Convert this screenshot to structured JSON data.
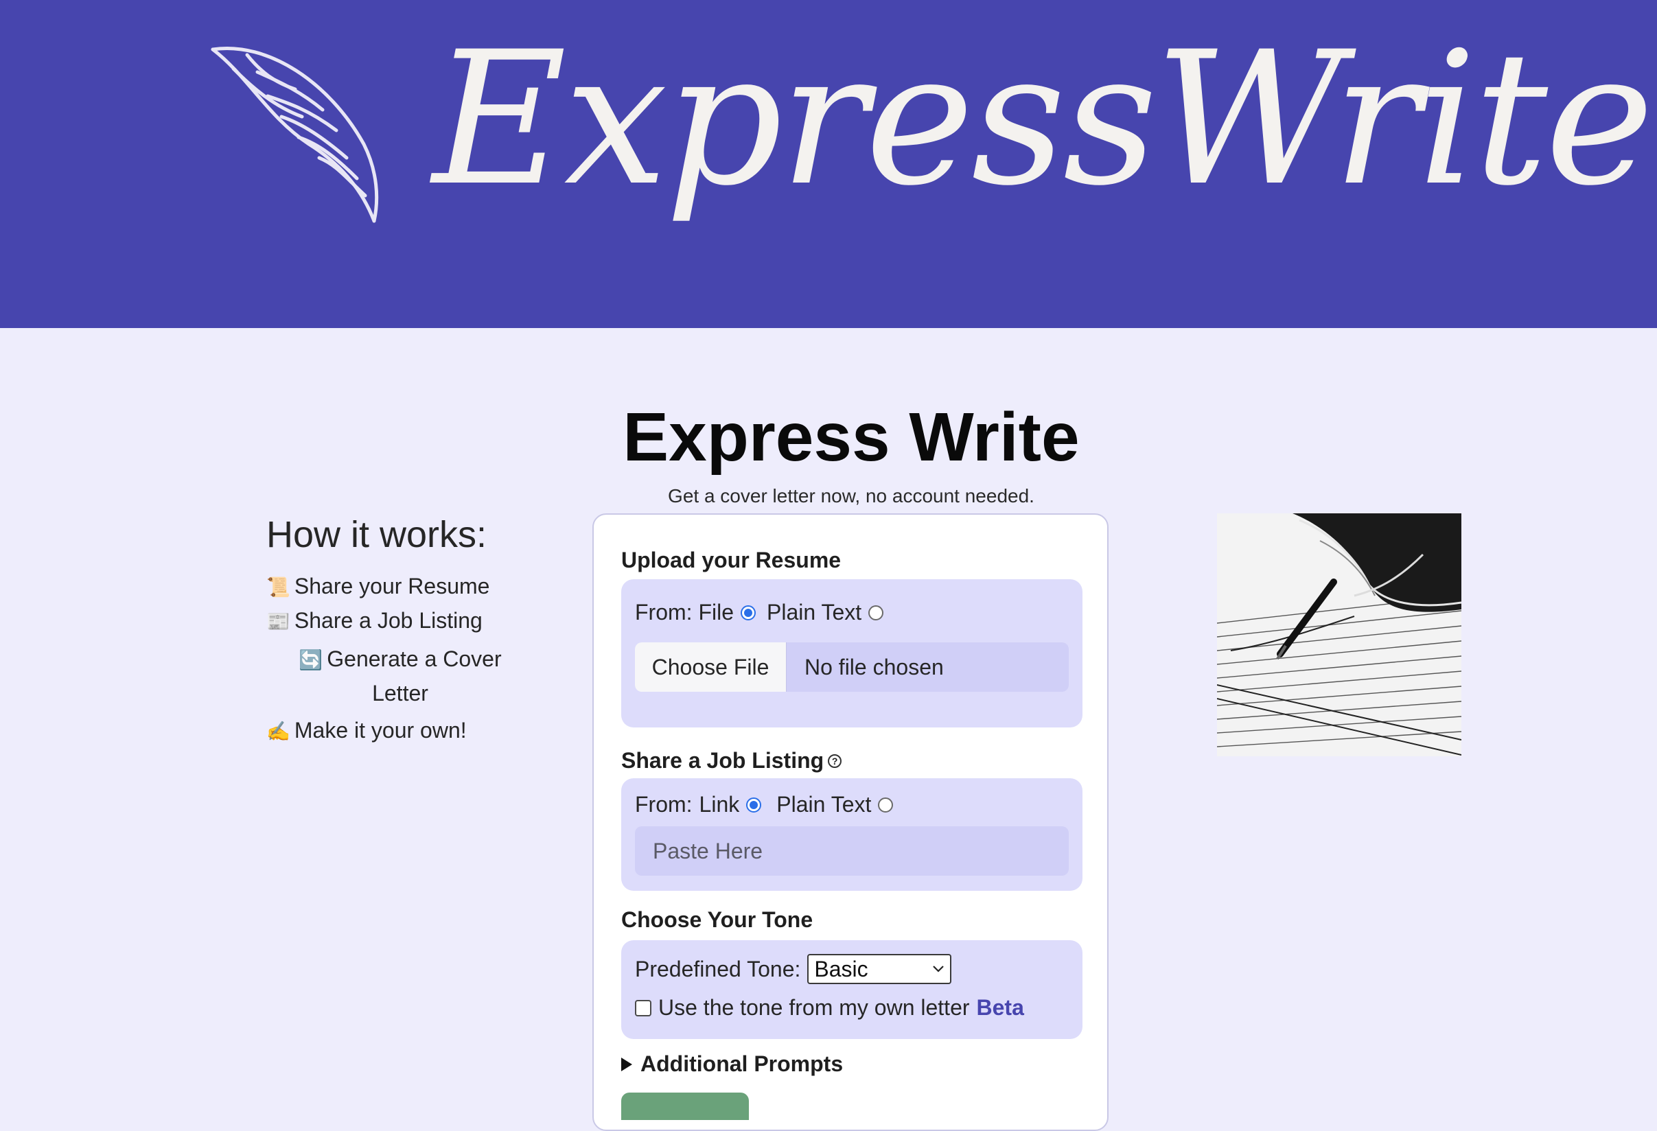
{
  "banner": {
    "brand": "ExpressWrite",
    "logo_icon": "quill-icon"
  },
  "page": {
    "title": "Express Write",
    "subtitle": "Get a cover letter now, no account needed."
  },
  "how_it_works": {
    "heading": "How it works:",
    "steps": [
      {
        "icon": "📜",
        "label": "Share your Resume"
      },
      {
        "icon": "📰",
        "label": "Share a Job Listing"
      },
      {
        "icon": "🔄",
        "label": "Generate a Cover Letter"
      },
      {
        "icon": "✍️",
        "label": "Make it your own!"
      }
    ]
  },
  "form": {
    "resume": {
      "title": "Upload your Resume",
      "from_label": "From: File",
      "option_plain": "Plain Text",
      "selected": "File",
      "file_button": "Choose File",
      "file_status": "No file chosen"
    },
    "job": {
      "title": "Share a Job Listing",
      "help_icon": "question-circle-icon",
      "from_label": "From:",
      "option_link": "Link",
      "option_plain": "Plain Text",
      "selected": "Link",
      "placeholder": "Paste Here"
    },
    "tone": {
      "title": "Choose Your Tone",
      "predefined_label": "Predefined Tone:",
      "selected_tone": "Basic",
      "own_letter_label": "Use the tone from my own letter",
      "beta_label": "Beta",
      "own_letter_checked": false
    },
    "additional": {
      "label": "Additional Prompts",
      "expanded": false
    }
  },
  "colors": {
    "banner": "#4745ae",
    "page_bg": "#eeedfc",
    "panel": "#dddcfb",
    "accent": "#2b6fe8"
  },
  "illustration": {
    "subject": "hand-writing-with-pen-illustration"
  }
}
